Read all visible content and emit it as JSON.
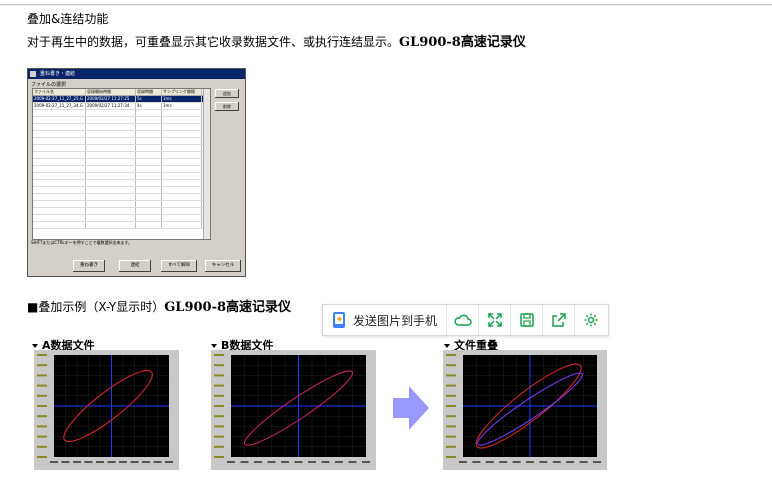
{
  "intro": {
    "title": "叠加&连结功能",
    "desc": "对于再生中的数据，可重叠显示其它收录数据文件、或执行连结显示。",
    "model": "GL900-8高速记录仪"
  },
  "dialog": {
    "title": "重ね書き・連結",
    "group_label": "ファイルの選択",
    "columns": [
      "ファイル名",
      "収録開始時間",
      "収録時間",
      "サンプリング間隔"
    ],
    "rows": [
      [
        "2009-02-27_11_27_25.G",
        "2009/02/27 11:27:25",
        "5s",
        "1ms"
      ],
      [
        "2009-02-27_11_27_34.G",
        "2009/02/27 11:27:34",
        "4s",
        "1ms"
      ]
    ],
    "add_button": "追加",
    "delete_button": "削除",
    "hint": "SHIFTまたはCTRLキーを押すことで複数選択出来ます。",
    "overlay_button": "重ね書き",
    "concat_button": "連結",
    "clear_all_button": "すべて解除",
    "cancel_button": "キャンセル"
  },
  "section2": {
    "title": "■叠加示例（X-Y显示时）",
    "model": "GL900-8高速记录仪"
  },
  "toolbar": {
    "send_label": "发送图片到手机",
    "icons": [
      "cloud-icon",
      "expand-icon",
      "save-icon",
      "share-icon",
      "settings-icon"
    ],
    "accent": "#16a34a"
  },
  "captions": {
    "a": "A数据文件",
    "b": "B数据文件",
    "c": "文件重叠"
  },
  "colors": {
    "plot_bg": "#000000",
    "axis": "#1d3cff",
    "trace_a": "#e0262a",
    "trace_b": "#d0206a",
    "arrow": "#9999ff"
  }
}
